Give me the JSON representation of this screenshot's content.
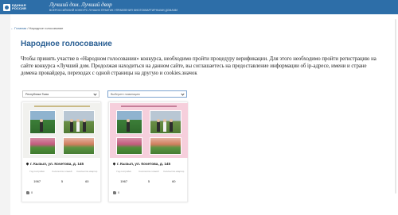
{
  "header": {
    "logo_line1": "ЕДИНАЯ",
    "logo_line2": "РОССИЯ",
    "title": "Лучший дом. Лучший двор",
    "subtitle": "ВСЕРОССИЙСКИЙ КОНКУРС ЛУЧШИХ ПРАКТИК УПРАВЛЕНИЯ МНОГОКВАРТИРНЫМИ ДОМАМИ"
  },
  "breadcrumb": {
    "back": "← Главная",
    "separator": "/",
    "current": "Народное голосование"
  },
  "page_title": "Народное голосование",
  "intro_text": "Чтобы принять участие в «Народном голосовании» конкурса, необходимо пройти процедуру верификации. Для этого необходимо пройти регистрацию на сайте конкурса «Лучший дом. Продолжая находиться на данном сайте, вы соглашаетесь на предоставление информации об ip-адресе, имени и стране домена провайдера, переходах с одной страницы на другую и cookies.значок",
  "filters": {
    "region_value": "Республика Тыва",
    "nomination_placeholder": "Выберите номинацию"
  },
  "cards": [
    {
      "photo_caption": "Номинация: Лучшая практика работы совета МКД",
      "address": "г. Кызыл, ул. Кочетова, д. 145",
      "stats": [
        {
          "label": "Год постройки",
          "value": "1967"
        },
        {
          "label": "Количество этажей",
          "value": "5"
        },
        {
          "label": "Количество квартир",
          "value": "60"
        }
      ],
      "likes": "0"
    },
    {
      "photo_caption": "Номинация: Лучшая практика работы совета МКД",
      "address": "г. Кызыл, ул. Кочетова, д. 145",
      "stats": [
        {
          "label": "Год постройки",
          "value": "1967"
        },
        {
          "label": "Количество этажей",
          "value": "5"
        },
        {
          "label": "Количество квартир",
          "value": "60"
        }
      ],
      "likes": "0"
    }
  ],
  "colors": {
    "header_bg": "#2d6ea8",
    "title_blue": "#2a5f93",
    "card2_photo_bg": "#f6cfdc"
  },
  "icons": [
    "logo-bear-icon",
    "chevron-down-icon",
    "map-pin-icon",
    "thumb-up-icon"
  ]
}
